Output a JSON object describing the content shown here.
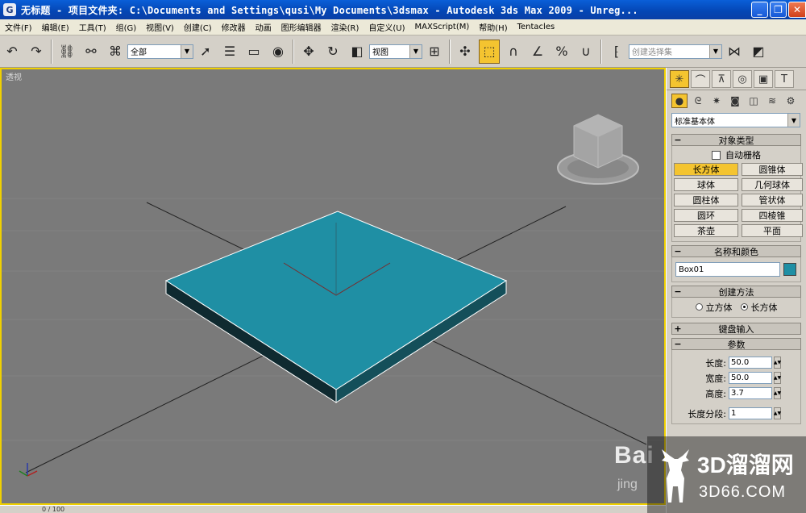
{
  "window": {
    "title": "无标题   - 项目文件夹: C:\\Documents and Settings\\qusi\\My Documents\\3dsmax   - Autodesk 3ds Max  2009  - Unreg...",
    "app_icon": "3ds-max-icon",
    "controls": [
      "minimize",
      "maximize",
      "close"
    ]
  },
  "menu": [
    "文件(F)",
    "编辑(E)",
    "工具(T)",
    "组(G)",
    "视图(V)",
    "创建(C)",
    "修改器",
    "动画",
    "图形编辑器",
    "渲染(R)",
    "自定义(U)",
    "MAXScript(M)",
    "帮助(H)",
    "Tentacles"
  ],
  "toolbar": {
    "selection_filter": "全部",
    "reference_coord": "视图",
    "named_selection_placeholder": "创建选择集",
    "active_tool": "select-and-manipulate"
  },
  "viewport": {
    "label": "透视",
    "object_color": "#1f8fa4",
    "background": "#7a7a7a",
    "border_color": "#f0d000"
  },
  "command_panel": {
    "category_dropdown": "标准基本体",
    "object_type": {
      "header": "对象类型",
      "auto_grid": "自动栅格",
      "buttons": [
        "长方体",
        "圆锥体",
        "球体",
        "几何球体",
        "圆柱体",
        "管状体",
        "圆环",
        "四棱锥",
        "茶壶",
        "平面"
      ],
      "active": "长方体"
    },
    "name_color": {
      "header": "名称和颜色",
      "name": "Box01",
      "color": "#1f8fa4"
    },
    "creation_method": {
      "header": "创建方法",
      "options": [
        "立方体",
        "长方体"
      ],
      "selected": "长方体"
    },
    "keyboard_entry": {
      "header": "键盘输入"
    },
    "parameters": {
      "header": "参数",
      "length_label": "长度:",
      "length": "50.0",
      "width_label": "宽度:",
      "width": "50.0",
      "height_label": "高度:",
      "height": "3.7",
      "length_segs_label": "长度分段:",
      "length_segs": "1"
    }
  },
  "status": {
    "time": "0 / 100"
  },
  "watermarks": {
    "baidu": "Bai",
    "jingyan": "jing",
    "site_main": "3D溜溜网",
    "site_sub": "3D66.COM"
  }
}
